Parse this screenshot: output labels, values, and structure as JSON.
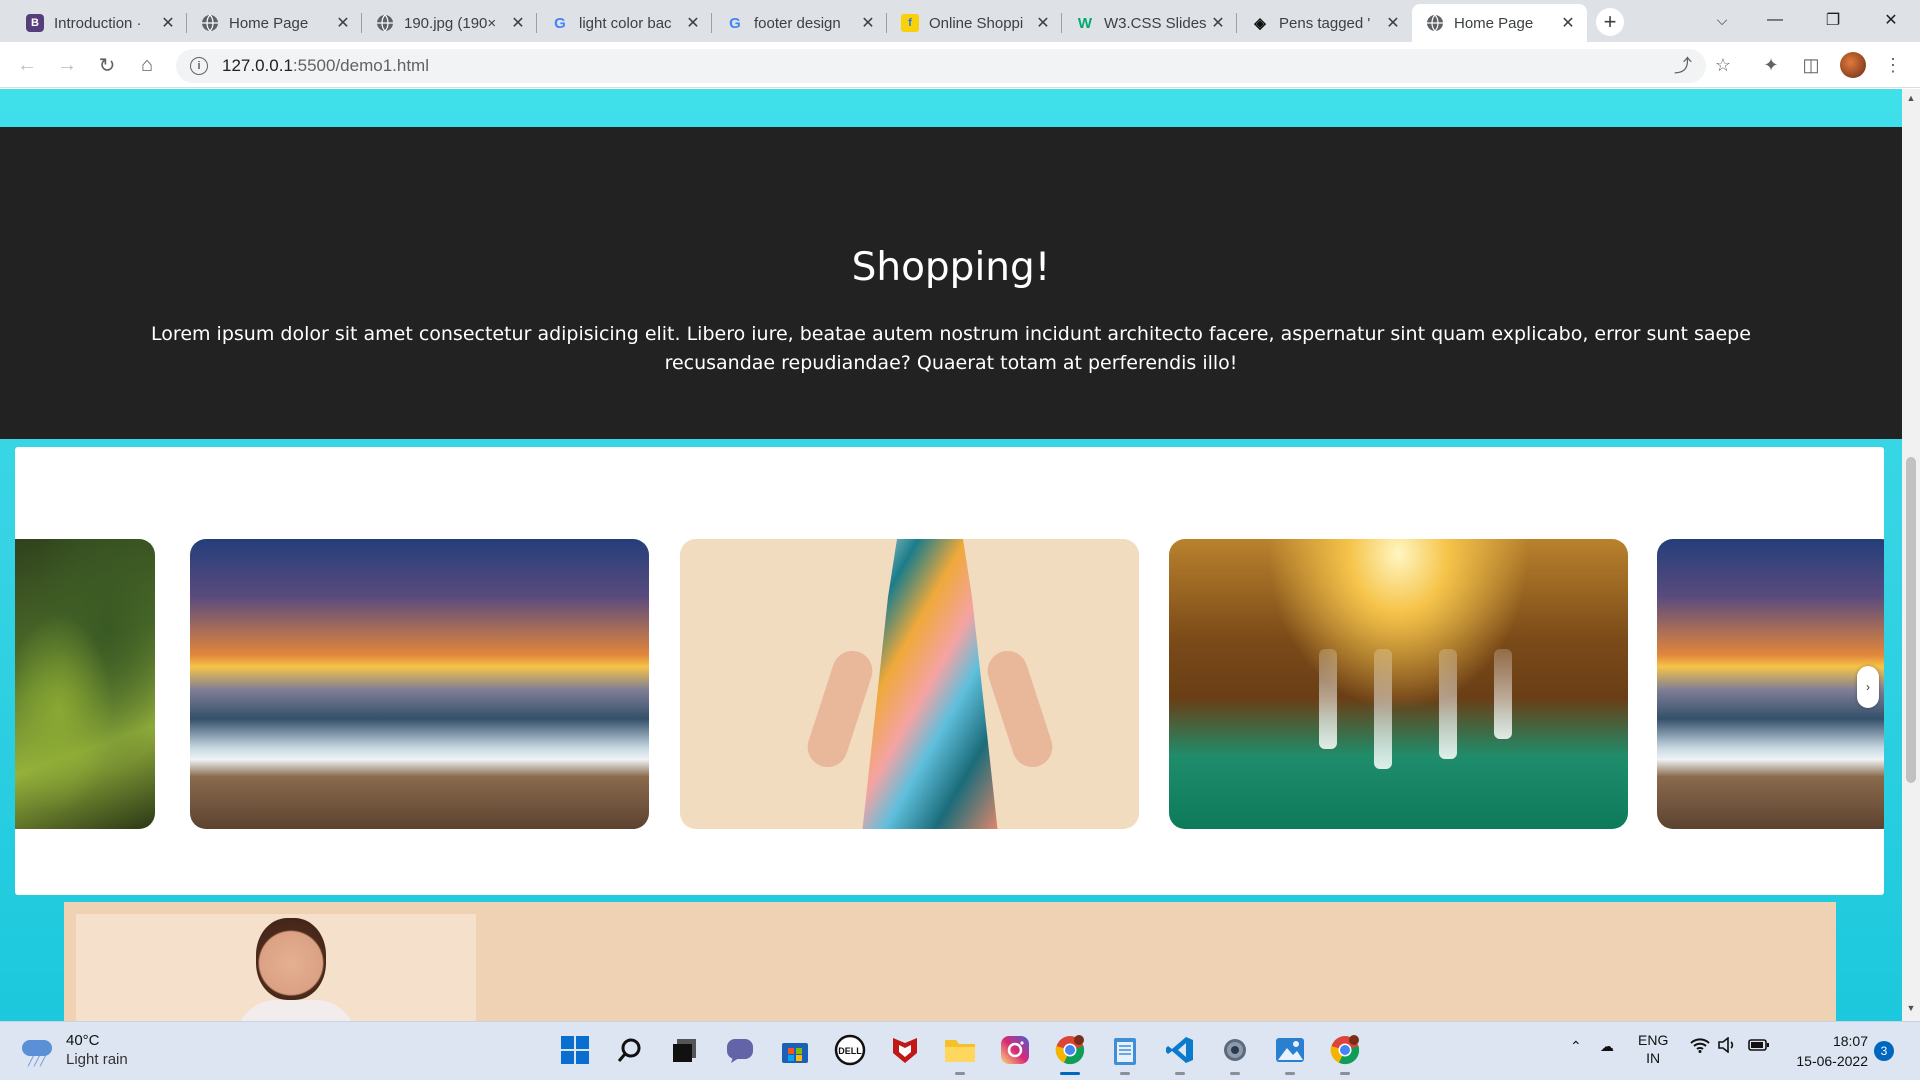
{
  "browser": {
    "tabs": [
      {
        "title": "Introduction ·",
        "favicon": "bootstrap-icon",
        "color": "#563d7c",
        "glyph": "B"
      },
      {
        "title": "Home Page",
        "favicon": "globe-icon",
        "color": "#5f6368",
        "glyph": ""
      },
      {
        "title": "190.jpg (190×",
        "favicon": "globe-icon",
        "color": "#5f6368",
        "glyph": ""
      },
      {
        "title": "light color bac",
        "favicon": "google-icon",
        "color": "#4285f4",
        "glyph": "G"
      },
      {
        "title": "footer design",
        "favicon": "google-icon",
        "color": "#4285f4",
        "glyph": "G"
      },
      {
        "title": "Online Shoppi",
        "favicon": "flipkart-icon",
        "color": "#f8d10a",
        "glyph": "f"
      },
      {
        "title": "W3.CSS Slides",
        "favicon": "w3schools-icon",
        "color": "#04aa6d",
        "glyph": "W"
      },
      {
        "title": "Pens tagged '",
        "favicon": "codepen-icon",
        "color": "#111111",
        "glyph": "◈"
      },
      {
        "title": "Home Page",
        "favicon": "globe-icon",
        "color": "#5f6368",
        "glyph": "",
        "active": true
      }
    ],
    "url_host": "127.0.0.1",
    "url_path": ":5500/demo1.html"
  },
  "page": {
    "hero": {
      "heading": "Shopping!",
      "text": "Lorem ipsum dolor sit amet consectetur adipisicing elit. Libero iure, beatae autem nostrum incidunt architecto facere, aspernatur sint quam explicabo, error sunt saepe recusandae repudiandae? Quaerat totam at perferendis illo!"
    },
    "slider": {
      "slides": [
        "forest",
        "sunset-sea",
        "patterned-dress",
        "waterfall",
        "sunset-sea"
      ],
      "next_glyph": "›"
    },
    "colors": {
      "hero_bg": "#232222",
      "page_bg": "#3fe0ea",
      "promo_bg": "#efd2b4"
    }
  },
  "taskbar": {
    "weather": {
      "temp": "40°C",
      "condition": "Light rain"
    },
    "apps": [
      "windows-start-icon",
      "search-icon",
      "task-view-icon",
      "teams-chat-icon",
      "microsoft-store-icon",
      "dell-icon",
      "mcafee-icon",
      "file-explorer-icon",
      "instagram-icon",
      "chrome-icon",
      "notepad-icon",
      "vscode-icon",
      "settings-icon",
      "photos-icon",
      "chrome-profile-icon"
    ],
    "language": {
      "line1": "ENG",
      "line2": "IN"
    },
    "clock": {
      "time": "18:07",
      "date": "15-06-2022"
    },
    "notifications": "3"
  }
}
